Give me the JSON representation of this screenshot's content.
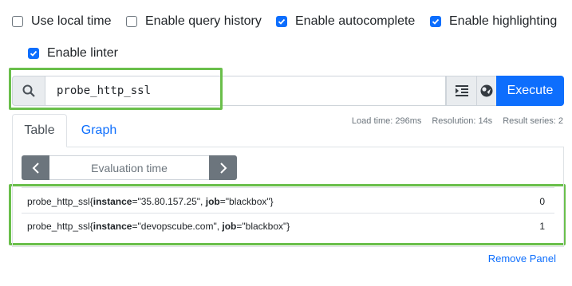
{
  "options": [
    {
      "label": "Use local time",
      "checked": false
    },
    {
      "label": "Enable query history",
      "checked": false
    },
    {
      "label": "Enable autocomplete",
      "checked": true
    },
    {
      "label": "Enable highlighting",
      "checked": true
    },
    {
      "label": "Enable linter",
      "checked": true
    }
  ],
  "query": {
    "value": "probe_http_ssl",
    "icons": [
      "search-icon",
      "format-query-icon",
      "metrics-explorer-icon"
    ],
    "execute_label": "Execute"
  },
  "stats": {
    "load_time": "Load time: 296ms",
    "resolution": "Resolution: 14s",
    "result_series": "Result series: 2"
  },
  "tabs": {
    "table_label": "Table",
    "graph_label": "Graph",
    "active": "Table"
  },
  "eval": {
    "placeholder": "Evaluation time"
  },
  "results": [
    {
      "metric": "probe_http_ssl",
      "instance": "35.80.157.25",
      "job": "blackbox",
      "value": "0"
    },
    {
      "metric": "probe_http_ssl",
      "instance": "devopscube.com",
      "job": "blackbox",
      "value": "1"
    }
  ],
  "remove_panel_label": "Remove Panel",
  "colors": {
    "accent": "#0d6efd",
    "highlight": "#6abf4b"
  }
}
